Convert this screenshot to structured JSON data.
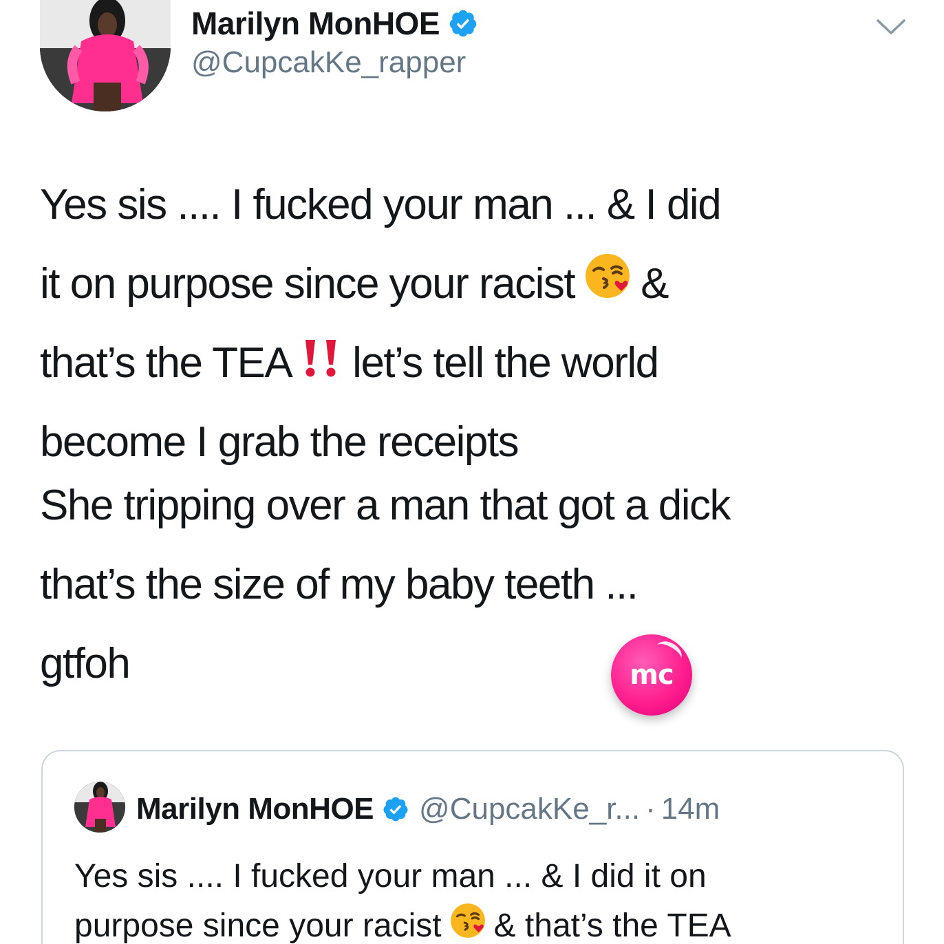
{
  "tweet": {
    "author": {
      "display_name": "Marilyn MonHOE",
      "handle": "@CupcakKe_rapper",
      "verified": true,
      "avatar": "profile-photo"
    },
    "text_lines": [
      "Yes sis .... I fucked your man ... & I did",
      "it on purpose since your racist",
      "&",
      "that’s the TEA",
      "let’s tell the world",
      "become I grab the receipts",
      "She tripping over a man that got a dick",
      "that’s the size of my baby teeth ...",
      "gtfoh"
    ],
    "emojis": [
      "face-blowing-a-kiss",
      "double-exclamation-mark"
    ]
  },
  "watermark": {
    "text": "mc",
    "color": "#ff1f8e"
  },
  "quoted_tweet": {
    "display_name": "Marilyn MonHOE",
    "handle": "@CupcakKe_r...",
    "separator": "·",
    "time": "14m",
    "text_lines": [
      "Yes sis .... I fucked your man ... & I did it on",
      "purpose since your racist",
      "& that’s the TEA"
    ]
  },
  "colors": {
    "verified_blue": "#1da1f2",
    "text_primary": "#14171a",
    "text_secondary": "#657786",
    "border": "#ccd6dd"
  },
  "icons": [
    "verified-badge-icon",
    "chevron-down-icon"
  ]
}
